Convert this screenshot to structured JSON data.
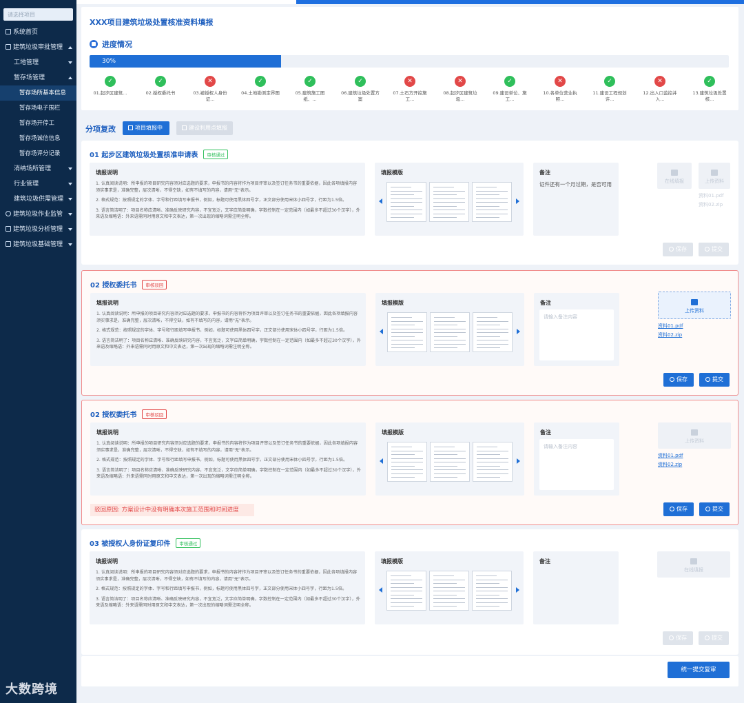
{
  "sidebar": {
    "search_placeholder": "请选择项目",
    "items": [
      {
        "label": "系统首页",
        "level": 1
      },
      {
        "label": "建筑垃圾审批管理",
        "level": 1
      },
      {
        "label": "工地管理",
        "level": 2
      },
      {
        "label": "暂存场管理",
        "level": 2
      },
      {
        "label": "暂存场所基本信息",
        "level": 3,
        "active": true
      },
      {
        "label": "暂存场电子围栏",
        "level": 3
      },
      {
        "label": "暂存场开停工",
        "level": 3
      },
      {
        "label": "暂存场诚信信息",
        "level": 3
      },
      {
        "label": "暂存场评分记录",
        "level": 3
      },
      {
        "label": "消纳场所管理",
        "level": 2
      },
      {
        "label": "行业管理",
        "level": 2
      },
      {
        "label": "建筑垃圾供需管理",
        "level": 2
      },
      {
        "label": "建筑垃圾作业监管",
        "level": 1
      },
      {
        "label": "建筑垃圾分析管理",
        "level": 1
      },
      {
        "label": "建筑垃圾基础管理",
        "level": 1
      }
    ]
  },
  "page": {
    "title": "XXX项目建筑垃圾处置核准资料填报",
    "progress_label": "进度情况",
    "progress_value": 30,
    "progress_text": "30%"
  },
  "steps": [
    {
      "label": "01.起步区建筑...",
      "status": "ok"
    },
    {
      "label": "02.授权委托书",
      "status": "ok"
    },
    {
      "label": "03.被授权人身份证...",
      "status": "err"
    },
    {
      "label": "04.土地勘测定界图",
      "status": "ok"
    },
    {
      "label": "05.建筑施工图纸、...",
      "status": "ok"
    },
    {
      "label": "06.建筑垃圾处置方案",
      "status": "ok"
    },
    {
      "label": "07.土石方开挖施工...",
      "status": "err"
    },
    {
      "label": "08.起步区建筑垃圾...",
      "status": "err"
    },
    {
      "label": "09.建设单位、施工...",
      "status": "ok"
    },
    {
      "label": "10.各单位营业执照...",
      "status": "err"
    },
    {
      "label": "11.建设工程规划许...",
      "status": "ok"
    },
    {
      "label": "12.出入口监控并入...",
      "status": "err"
    },
    {
      "label": "13.建筑垃圾处置核...",
      "status": "ok"
    }
  ],
  "subtabs": {
    "label": "分项复改",
    "tab_on": "项目填报中",
    "tab_off": "建设利用点填报"
  },
  "common": {
    "instr_title": "填报说明",
    "tpl_title": "填报模版",
    "note_title": "备注",
    "note_placeholder": "请输入备注内容",
    "instr_lines": [
      "1. 认真阅读说明：所申报的项目研究内容须对应选题的要求，申报书的内容将作为项目评审以及签订任务书的重要依据，因此各项填报内容须实事求是，准确完整，层次清晰，不得空缺，如有不填写的内容，请用\"无\"表示。",
      "2. 格式规范：按照规定的字体、字号和行距填写申报书，例如，标题可使用黑体四号字，正文部分使用宋体小四号字，行距为1.5倍。",
      "3. 语言简洁明了：项目名称应清晰、准确反映研究内容，不宜宽泛，文字应简单明确，字数控制在一定范围内（如最多不超过30个汉字），外来语及缩略语：外来语需同时用原文和中文表达，第一次出现的缩略词需注明全称。"
    ],
    "upload_label": "上传资料",
    "online_label": "在线填报",
    "file1": "资料01.pdf",
    "file2": "资料02.zip",
    "save": "保存",
    "submit": "提交"
  },
  "sections": [
    {
      "title": "01  起步区建筑垃圾处置核准申请表",
      "badge": "审核通过",
      "note_text": "证件还有一个月过期，是否可用"
    },
    {
      "title": "02  授权委托书",
      "badge": "审核驳回"
    },
    {
      "title": "02  授权委托书",
      "badge": "审核驳回",
      "reason": "驳回原因: 方案设计中没有明确本次施工范围和时间进度"
    },
    {
      "title": "03  被授权人身份证复印件",
      "badge": "审核通过"
    }
  ],
  "final_button": "统一提交复审",
  "watermark": "大数跨境",
  "colors": {
    "primary": "#1f6fd6",
    "success": "#2fbf5b",
    "danger": "#e24848",
    "sidebar": "#0d2a4a"
  }
}
